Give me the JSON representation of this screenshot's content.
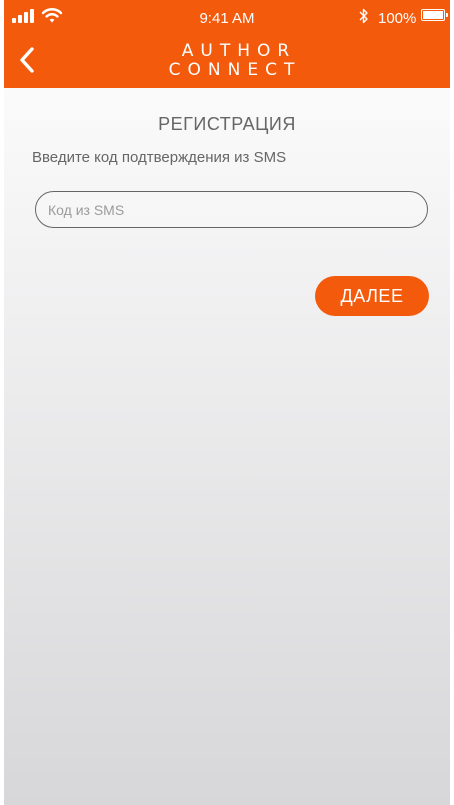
{
  "status_bar": {
    "time": "9:41 AM",
    "battery": "100%",
    "icons": [
      "signal-icon",
      "wifi-icon",
      "bluetooth-icon",
      "battery-icon"
    ]
  },
  "header": {
    "back_icon": "chevron-left-icon",
    "logo_line1": "AUTHOR",
    "logo_line2": "CONNECT",
    "background_color": "#f45a0c"
  },
  "registration": {
    "title": "РЕГИСТРАЦИЯ",
    "instruction": "Введите код подтверждения из SMS",
    "sms_code": {
      "value": "",
      "placeholder": "Код из SMS"
    },
    "next_label": "ДАЛЕЕ"
  },
  "colors": {
    "accent": "#f45a0c",
    "text": "#666666",
    "placeholder": "#9b9b9b"
  }
}
